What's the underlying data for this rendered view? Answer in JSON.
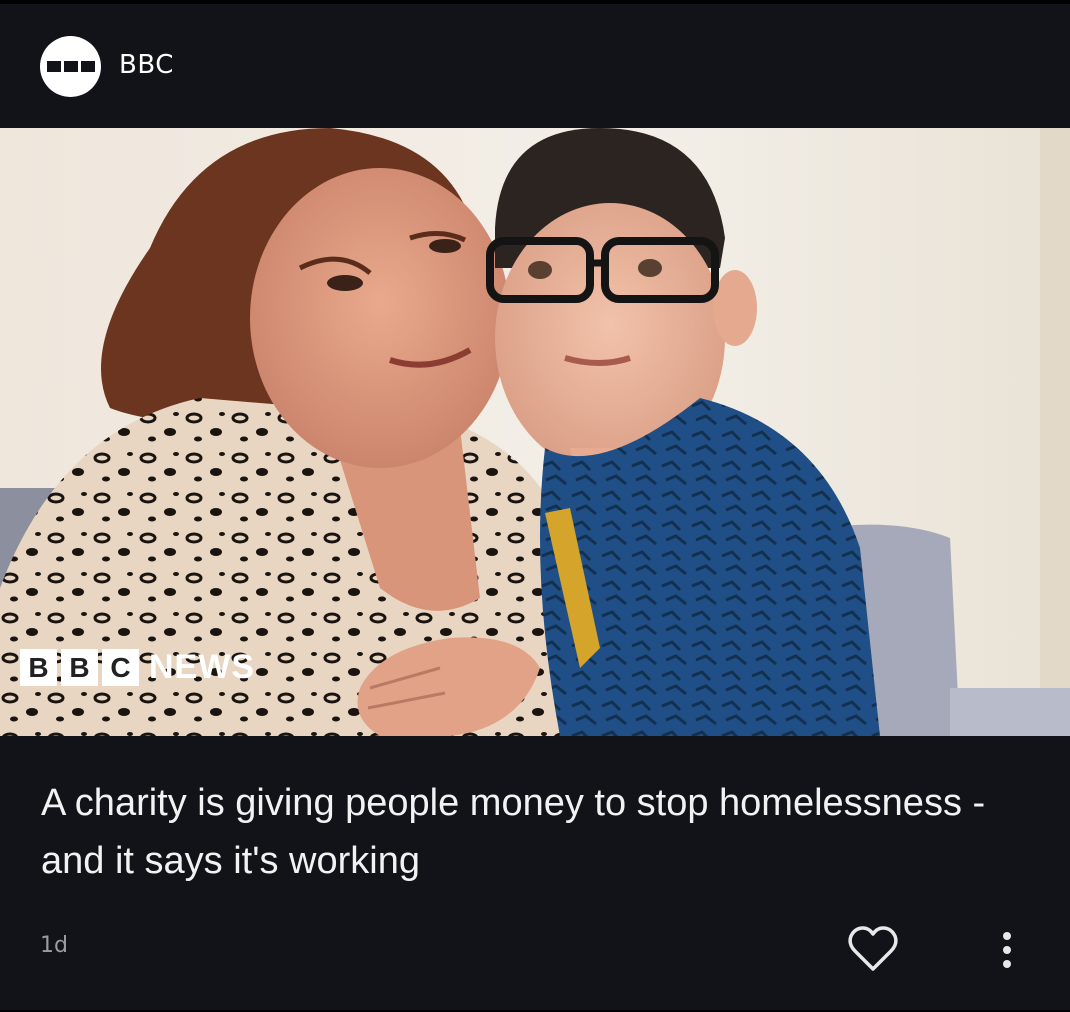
{
  "source": {
    "name": "BBC",
    "logo_icon": "bbc-blocks-logo-icon"
  },
  "hero": {
    "watermark_letters": [
      "B",
      "B",
      "C"
    ],
    "watermark_word": "NEWS"
  },
  "article": {
    "headline": "A charity is giving people money to stop homelessness - and it says it's working",
    "age": "1d"
  },
  "actions": {
    "like_icon": "heart-outline-icon",
    "more_icon": "more-vertical-icon"
  },
  "colors": {
    "background": "#111318",
    "text": "#f2f2f2",
    "muted": "#9a9ca3"
  }
}
